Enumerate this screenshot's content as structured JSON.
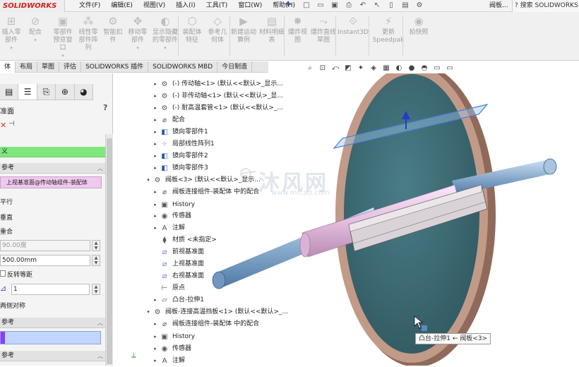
{
  "app": {
    "logo_text": "SOLIDWORKS",
    "doc_name": "阀板...",
    "search_text": "搜索 SOLIDWORKS"
  },
  "menus": [
    "文件(F)",
    "编辑(E)",
    "视图(V)",
    "插入(I)",
    "工具(T)",
    "窗口(W)",
    "帮助(H)"
  ],
  "ribbon": [
    {
      "label": "插入零部件",
      "icon": "insert-icon"
    },
    {
      "label": "配合",
      "icon": "mate-icon"
    },
    {
      "label": "零部件预览窗口",
      "icon": "preview-icon"
    },
    {
      "label": "线性零部件阵列",
      "icon": "pattern-icon"
    },
    {
      "label": "智能扣件",
      "icon": "fastener-icon"
    },
    {
      "label": "移动零部件",
      "icon": "move-icon"
    },
    {
      "label": "显示隐藏的零部件",
      "icon": "show-hide-icon"
    },
    {
      "label": "装配体特征",
      "icon": "assembly-feature-icon"
    },
    {
      "label": "参考几何体",
      "icon": "reference-geometry-icon"
    },
    {
      "label": "新建运动算例",
      "icon": "motion-study-icon"
    },
    {
      "label": "材料明细表",
      "icon": "bom-icon"
    },
    {
      "label": "爆炸视图",
      "icon": "explode-icon"
    },
    {
      "label": "爆炸直线草图",
      "icon": "explode-line-icon"
    },
    {
      "label": "Instant3D",
      "icon": "instant3d-icon"
    },
    {
      "label": "更新Speedpak",
      "icon": "speedpak-icon"
    },
    {
      "label": "拍快照",
      "icon": "snapshot-icon"
    }
  ],
  "tabs": [
    "体",
    "布局",
    "草图",
    "评估",
    "SOLIDWORKS 插件",
    "SOLIDWORKS MBD",
    "今日制造"
  ],
  "panel": {
    "title": "准面",
    "help": "?",
    "reference_header": "参考",
    "option_text": "义",
    "reference1": "上视基准面@传动轴组件-装配体",
    "parallel": "平行",
    "perpendicular": "垂直",
    "coincident": "重合",
    "angle": "90.00度",
    "distance": "500.00mm",
    "flip_offset": "反转等距",
    "count": "1",
    "mid_plane": "两侧对称",
    "second_reference": "参考",
    "third_reference": "参考"
  },
  "tree": [
    {
      "label": "(-) 传动轴<1> (默认<<默认>_显示...",
      "icon": "part-icon",
      "indent": 0
    },
    {
      "label": "(-) 非传动轴<1> (默认<<默认>_显...",
      "icon": "part-icon",
      "indent": 0
    },
    {
      "label": "(-) 耐高温套管<1> (默认<<默认>_...",
      "icon": "part-icon",
      "indent": 0
    },
    {
      "label": "配合",
      "icon": "mate-icon",
      "indent": 0
    },
    {
      "label": "镜向零部件1",
      "icon": "mirror-icon",
      "indent": 0
    },
    {
      "label": "局部线性阵列1",
      "icon": "pattern-icon",
      "indent": 0
    },
    {
      "label": "镜向零部件2",
      "icon": "mirror-icon",
      "indent": 0
    },
    {
      "label": "镜向零部件3",
      "icon": "mirror-icon",
      "indent": 0
    },
    {
      "label": "阀板<3> (默认<<默认>_显示...",
      "icon": "part-icon",
      "indent": -1
    },
    {
      "label": "阀板连接组件-装配体 中的配合",
      "icon": "mate-icon",
      "indent": 0
    },
    {
      "label": "History",
      "icon": "history-icon",
      "indent": 0
    },
    {
      "label": "传感器",
      "icon": "sensor-icon",
      "indent": 0
    },
    {
      "label": "注解",
      "icon": "annotation-icon",
      "indent": 0
    },
    {
      "label": "材质 <未指定>",
      "icon": "material-icon",
      "indent": 0
    },
    {
      "label": "前视基准面",
      "icon": "plane-icon",
      "indent": 0
    },
    {
      "label": "上视基准面",
      "icon": "plane-icon",
      "indent": 0
    },
    {
      "label": "右视基准面",
      "icon": "plane-icon",
      "indent": 0
    },
    {
      "label": "原点",
      "icon": "origin-icon",
      "indent": 0
    },
    {
      "label": "凸台-拉伸1",
      "icon": "extrude-icon",
      "indent": 0
    },
    {
      "label": "阀板-连接高温挡板<1> (默认<<默认>_...",
      "icon": "part-icon",
      "indent": -1
    },
    {
      "label": "阀板连接组件-装配体 中的配合",
      "icon": "mate-icon",
      "indent": 0
    },
    {
      "label": "History",
      "icon": "history-icon",
      "indent": 0
    },
    {
      "label": "传感器",
      "icon": "sensor-icon",
      "indent": 0
    },
    {
      "label": "注解",
      "icon": "annotation-icon",
      "indent": 0
    }
  ],
  "tooltip": "凸台-拉伸1 ← 阀板<3>",
  "watermark": {
    "cn": "沐风网",
    "url": "www.mfcad.com"
  },
  "colors": {
    "plate_face": "#3d6b76",
    "plate_rim": "#b58a78",
    "shaft": "#8aaccd",
    "sleeve": "#e4bfe0",
    "plane_edge": "#4a7fd0",
    "selection_green": "#7ee77e",
    "selection_purple": "#8a3cff"
  }
}
